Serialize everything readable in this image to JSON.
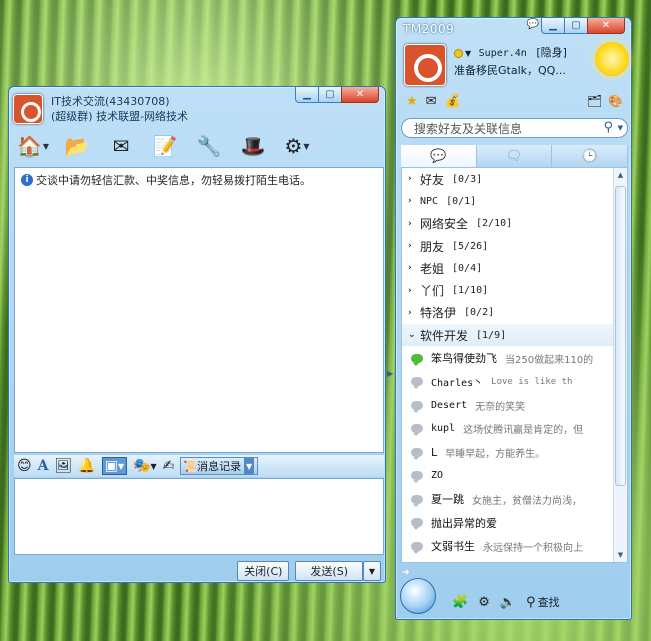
{
  "chat": {
    "title": "IT技术交流(43430708)",
    "subtitle": "(超级群) 技术联盟-网络技术",
    "notice": "交谈中请勿轻信汇款、中奖信息，勿轻易拨打陌生电话。",
    "history_label": "消息记录",
    "close_label": "关闭(C)",
    "send_label": "发送(S)"
  },
  "qq": {
    "title": "TM2009",
    "nickname": "Super.4n",
    "status": "[隐身]",
    "signature": "准备移民Gtalk，QQ...",
    "search_placeholder": "搜索好友及关联信息",
    "find_label": "查找",
    "groups": [
      {
        "name": "好友",
        "count": "[0/3]"
      },
      {
        "name": "NPC",
        "count": "[0/1]"
      },
      {
        "name": "网络安全",
        "count": "[2/10]"
      },
      {
        "name": "朋友",
        "count": "[5/26]"
      },
      {
        "name": "老姐",
        "count": "[0/4]"
      },
      {
        "name": "丫们",
        "count": "[1/10]"
      },
      {
        "name": "特洛伊",
        "count": "[0/2]"
      },
      {
        "name": "软件开发",
        "count": "[1/9]"
      }
    ],
    "contacts": [
      {
        "name": "笨鸟得使劲飞",
        "sig": "当250做起来110的"
      },
      {
        "name": "Charles丶",
        "sig": "Love is like th"
      },
      {
        "name": "Desert",
        "sig": "无奈的笑笑"
      },
      {
        "name": "kupl",
        "sig": "这场仗腾讯赢是肯定的，但"
      },
      {
        "name": "L",
        "sig": "早睡早起，方能养生。"
      },
      {
        "name": "ZO",
        "sig": ""
      },
      {
        "name": "夏一跳",
        "sig": "女施主，贫僧法力尚浅，"
      },
      {
        "name": "抛出异常的爱",
        "sig": ""
      },
      {
        "name": "文弱书生",
        "sig": "永远保持一个积极向上"
      }
    ]
  }
}
